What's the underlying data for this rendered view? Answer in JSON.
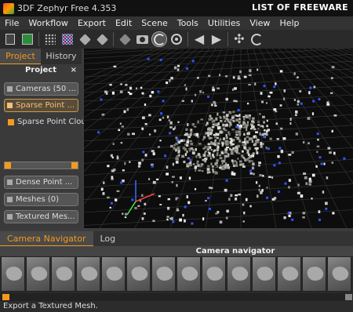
{
  "window": {
    "title": "3DF Zephyr Free 4.353",
    "watermark": "LIST OF FREEWARE"
  },
  "menu": [
    "File",
    "Workflow",
    "Export",
    "Edit",
    "Scene",
    "Tools",
    "Utilities",
    "View",
    "Help"
  ],
  "toolbar": {
    "icons": [
      "new-project-icon",
      "save-icon",
      "sparse-cloud-icon",
      "dense-cloud-icon",
      "mesh-icon",
      "textured-mesh-icon",
      "cube-icon",
      "cube-dark-icon",
      "camera-icon",
      "orbit-icon",
      "pivot-icon",
      "back-arrow-icon",
      "forward-arrow-icon",
      "fit-icon",
      "reset-icon"
    ]
  },
  "left_panel": {
    "tabs": [
      {
        "label": "Project",
        "active": true
      },
      {
        "label": "History",
        "active": false
      }
    ],
    "header": "Project",
    "close": "×",
    "items": [
      {
        "label": "Cameras (50 ...",
        "active": false
      },
      {
        "label": "Sparse Point ...",
        "active": true
      }
    ],
    "checkbox_item": "Sparse Point Clou",
    "lower_items": [
      {
        "label": "Dense Point ..."
      },
      {
        "label": "Meshes (0)"
      },
      {
        "label": "Textured Mes..."
      }
    ],
    "slider_value": 0
  },
  "bottom": {
    "tabs": [
      {
        "label": "Camera Navigator",
        "active": true
      },
      {
        "label": "Log",
        "active": false
      }
    ],
    "navigator_title": "Camera navigator",
    "thumbnail_count": 14
  },
  "status": {
    "text": "Export a Textured Mesh."
  },
  "colors": {
    "accent": "#f39a1e",
    "background": "#3c3c3c",
    "viewport": "#0d0d0d",
    "camera_markers": "#3355ff"
  }
}
